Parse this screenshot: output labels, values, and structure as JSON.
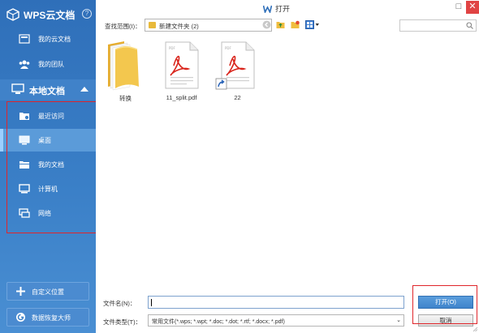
{
  "sidebar": {
    "brand": "WPS云文档",
    "help_symbol": "?",
    "cloud_items": [
      {
        "label": "我的云文档",
        "icon": "cloud-doc-icon"
      },
      {
        "label": "我的团队",
        "icon": "team-icon"
      }
    ],
    "section_label": "本地文档",
    "local_items": [
      {
        "label": "最近访问",
        "icon": "recent-folder-icon"
      },
      {
        "label": "桌面",
        "icon": "desktop-icon"
      },
      {
        "label": "我的文档",
        "icon": "documents-folder-icon"
      },
      {
        "label": "计算机",
        "icon": "computer-icon"
      },
      {
        "label": "网络",
        "icon": "network-icon"
      }
    ],
    "selected_item": "桌面",
    "add_location_label": "自定义位置",
    "recovery_label": "数据恢复大师"
  },
  "window": {
    "title": "打开",
    "minimize_symbol": "□",
    "close_symbol": "✕"
  },
  "toolbar": {
    "look_in_label": "查找范围(I)：",
    "look_in_value": "新建文件夹 (2)",
    "dropdown_symbol": "⌄"
  },
  "files": [
    {
      "name": "转换",
      "type": "folder"
    },
    {
      "name": "11_split.pdf",
      "type": "pdf"
    },
    {
      "name": "22",
      "type": "pdf-shortcut"
    }
  ],
  "bottom": {
    "filename_label": "文件名(N)：",
    "filename_value": "",
    "filetype_label": "文件类型(T)：",
    "filetype_value": "常用文件(*.wps; *.wpt; *.doc; *.dot; *.rtf; *.docx; *.pdf)",
    "open_button": "打开(O)",
    "cancel_button": "取消"
  },
  "colors": {
    "sidebar_blue": "#3a7fc7",
    "highlight_red": "#e0262b",
    "pdf_red": "#d9251c",
    "folder_yellow": "#f1c34a"
  }
}
